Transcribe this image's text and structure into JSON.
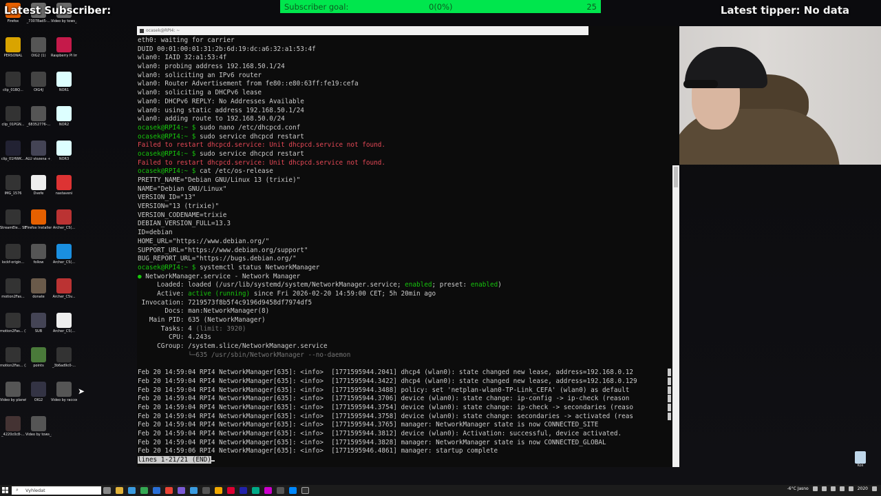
{
  "overlay": {
    "latest_subscriber": "Latest Subscriber:",
    "subscriber_goal_label": "Subscriber goal:",
    "subscriber_goal_value": "0(0%)",
    "subscriber_goal_target": "25",
    "latest_tipper": "Latest tipper: No data",
    "goal_bar_color": "#00e64d"
  },
  "desktop_icons": [
    {
      "label": "Firefox",
      "color": "#e66000",
      "icon": "firefox-icon"
    },
    {
      "label": "_73078ad5-...",
      "color": "#6a6a6a",
      "icon": "image-file-icon"
    },
    {
      "label": "Video by tows_and_t...",
      "color": "#6a6a6a",
      "icon": "video-file-icon"
    },
    {
      "label": "PERSONAL",
      "color": "#d9a400",
      "icon": "folder-icon"
    },
    {
      "label": "OIG2 (1)",
      "color": "#555",
      "icon": "image-file-icon"
    },
    {
      "label": "Raspberry Pi Imager",
      "color": "#c51a4a",
      "icon": "raspberry-pi-icon"
    },
    {
      "label": "clip_01BQ...",
      "color": "#333",
      "icon": "image-file-icon"
    },
    {
      "label": "OIG4J",
      "color": "#444",
      "icon": "image-file-icon"
    },
    {
      "label": "NOR1",
      "color": "#dff",
      "icon": "document-icon"
    },
    {
      "label": "clip_01PGN...",
      "color": "#333",
      "icon": "image-file-icon"
    },
    {
      "label": "_68352776-...",
      "color": "#555",
      "icon": "image-file-icon"
    },
    {
      "label": "NOR2",
      "color": "#dff",
      "icon": "document-icon"
    },
    {
      "label": "clip_01HWK...",
      "color": "#223",
      "icon": "image-file-icon"
    },
    {
      "label": "ALU vlozena + jednostr...",
      "color": "#445",
      "icon": "image-file-icon"
    },
    {
      "label": "NOR3",
      "color": "#dff",
      "icon": "document-icon"
    },
    {
      "label": "IMG_1576",
      "color": "#333",
      "icon": "image-file-icon"
    },
    {
      "label": "Dvefe",
      "color": "#eee",
      "icon": "document-icon"
    },
    {
      "label": "nastaveni",
      "color": "#d33",
      "icon": "pdf-icon"
    },
    {
      "label": "StreamEle... SE.Live",
      "color": "#333",
      "icon": "app-icon"
    },
    {
      "label": "Firefox Installer",
      "color": "#e66000",
      "icon": "firefox-icon"
    },
    {
      "label": "Archer_C5(...",
      "color": "#b33",
      "icon": "archive-icon"
    },
    {
      "label": "lockf-origin...",
      "color": "#333",
      "icon": "app-icon"
    },
    {
      "label": "follow",
      "color": "#555",
      "icon": "image-file-icon"
    },
    {
      "label": "Archer_C5(...",
      "color": "#1a8fe0",
      "icon": "lightning-icon"
    },
    {
      "label": "motion2Fas...",
      "color": "#333",
      "icon": "image-file-icon"
    },
    {
      "label": "donate",
      "color": "#6a5a4a",
      "icon": "image-file-icon"
    },
    {
      "label": "Archer_C5v...",
      "color": "#b33",
      "icon": "archive-icon"
    },
    {
      "label": "motion2Fas... (1)",
      "color": "#333",
      "icon": "image-file-icon"
    },
    {
      "label": "SUB",
      "color": "#445",
      "icon": "image-file-icon"
    },
    {
      "label": "Archer_C5(...",
      "color": "#eee",
      "icon": "document-icon"
    },
    {
      "label": "motion2Fas... (2)",
      "color": "#333",
      "icon": "image-file-icon"
    },
    {
      "label": "points",
      "color": "#4a7a3a",
      "icon": "image-file-icon"
    },
    {
      "label": "_3b6ad9c0-...",
      "color": "#333",
      "icon": "image-file-icon"
    },
    {
      "label": "Video by planeta_en...",
      "color": "#555",
      "icon": "video-file-icon"
    },
    {
      "label": "OIG2",
      "color": "#334",
      "icon": "image-file-icon"
    },
    {
      "label": "Video by raccoon_sc...",
      "color": "#555",
      "icon": "video-file-icon"
    },
    {
      "label": "_4220c0c8-...",
      "color": "#433",
      "icon": "image-file-icon"
    },
    {
      "label": "Video by tows_and_t...",
      "color": "#555",
      "icon": "video-file-icon"
    }
  ],
  "terminal": {
    "title": "ocasek@RPI4: ~",
    "lines": [
      {
        "t": "eth0: waiting for carrier"
      },
      {
        "t": "DUID 00:01:00:01:31:2b:6d:19:dc:a6:32:a1:53:4f"
      },
      {
        "t": "wlan0: IAID 32:a1:53:4f"
      },
      {
        "t": "wlan0: probing address 192.168.50.1/24"
      },
      {
        "t": "wlan0: soliciting an IPv6 router"
      },
      {
        "t": "wlan0: Router Advertisement from fe80::e80:63ff:fe19:cefa"
      },
      {
        "t": "wlan0: soliciting a DHCPv6 lease"
      },
      {
        "t": "wlan0: DHCPv6 REPLY: No Addresses Available"
      },
      {
        "t": "wlan0: using static address 192.168.50.1/24"
      },
      {
        "t": "wlan0: adding route to 192.168.50.0/24"
      },
      {
        "prompt": "ocasek@RPI4:~ $ ",
        "t": "sudo nano /etc/dhcpcd.conf"
      },
      {
        "prompt": "ocasek@RPI4:~ $ ",
        "t": "sudo service dhcpcd restart"
      },
      {
        "t": "Failed to restart dhcpcd.service: Unit dhcpcd.service not found.",
        "c": "red"
      },
      {
        "prompt": "ocasek@RPI4:~ $ ",
        "t": "sudo service dhcpcd restart"
      },
      {
        "t": "Failed to restart dhcpcd.service: Unit dhcpcd.service not found.",
        "c": "red"
      },
      {
        "prompt": "ocasek@RPI4:~ $ ",
        "t": "cat /etc/os-release"
      },
      {
        "t": "PRETTY_NAME=\"Debian GNU/Linux 13 (trixie)\""
      },
      {
        "t": "NAME=\"Debian GNU/Linux\""
      },
      {
        "t": "VERSION_ID=\"13\""
      },
      {
        "t": "VERSION=\"13 (trixie)\""
      },
      {
        "t": "VERSION_CODENAME=trixie"
      },
      {
        "t": "DEBIAN_VERSION_FULL=13.3"
      },
      {
        "t": "ID=debian"
      },
      {
        "t": "HOME_URL=\"https://www.debian.org/\""
      },
      {
        "t": "SUPPORT_URL=\"https://www.debian.org/support\""
      },
      {
        "t": "BUG_REPORT_URL=\"https://bugs.debian.org/\""
      },
      {
        "prompt": "ocasek@RPI4:~ $ ",
        "t": "systemctl status NetworkManager"
      },
      {
        "bullet": "● ",
        "t": "NetworkManager.service - Network Manager"
      },
      {
        "t": "     Loaded: loaded (/usr/lib/systemd/system/NetworkManager.service; ",
        "g1": "enabled",
        "mid": "; preset: ",
        "g2": "enabled",
        "end": ")"
      },
      {
        "t": "     Active: ",
        "g1": "active (running)",
        "end": " since Fri 2026-02-20 14:59:00 CET; 5h 20min ago"
      },
      {
        "t": " Invocation: 7219573f8b5f4c9196d9458df7974df5"
      },
      {
        "t": "       Docs: man:NetworkManager(8)"
      },
      {
        "t": "   Main PID: 635 (NetworkManager)"
      },
      {
        "t": "      Tasks: 4 ",
        "d1": "(limit: 3920)"
      },
      {
        "t": "        CPU: 4.243s"
      },
      {
        "t": "     CGroup: /system.slice/NetworkManager.service"
      },
      {
        "d1": "             └─635 /usr/sbin/NetworkManager --no-daemon"
      },
      {
        "t": ""
      },
      {
        "t": "Feb 20 14:59:04 RPI4 NetworkManager[635]: <info>  [1771595944.2041] dhcp4 (wlan0): state changed new lease, address=192.168.0.12",
        "wrap": true
      },
      {
        "t": "Feb 20 14:59:04 RPI4 NetworkManager[635]: <info>  [1771595944.3422] dhcp4 (wlan0): state changed new lease, address=192.168.0.129",
        "wrap": true
      },
      {
        "t": "Feb 20 14:59:04 RPI4 NetworkManager[635]: <info>  [1771595944.3488] policy: set 'netplan-wlan0-TP-Link_CEFA' (wlan0) as default",
        "wrap": true
      },
      {
        "t": "Feb 20 14:59:04 RPI4 NetworkManager[635]: <info>  [1771595944.3706] device (wlan0): state change: ip-config -> ip-check (reason",
        "wrap": true
      },
      {
        "t": "Feb 20 14:59:04 RPI4 NetworkManager[635]: <info>  [1771595944.3754] device (wlan0): state change: ip-check -> secondaries (reaso",
        "wrap": true
      },
      {
        "t": "Feb 20 14:59:04 RPI4 NetworkManager[635]: <info>  [1771595944.3758] device (wlan0): state change: secondaries -> activated (reas",
        "wrap": true
      },
      {
        "t": "Feb 20 14:59:04 RPI4 NetworkManager[635]: <info>  [1771595944.3765] manager: NetworkManager state is now CONNECTED_SITE"
      },
      {
        "t": "Feb 20 14:59:04 RPI4 NetworkManager[635]: <info>  [1771595944.3812] device (wlan0): Activation: successful, device activated."
      },
      {
        "t": "Feb 20 14:59:04 RPI4 NetworkManager[635]: <info>  [1771595944.3828] manager: NetworkManager state is now CONNECTED_GLOBAL"
      },
      {
        "t": "Feb 20 14:59:06 RPI4 NetworkManager[635]: <info>  [1771595946.4861] manager: startup complete"
      },
      {
        "end_marker": "lines 1-21/21 (END)"
      }
    ]
  },
  "recycle_bin": {
    "label": "Koš"
  },
  "taskbar": {
    "search_placeholder": "Vyhledat",
    "weather": "-6°C  Jasno",
    "clock": "2020"
  }
}
